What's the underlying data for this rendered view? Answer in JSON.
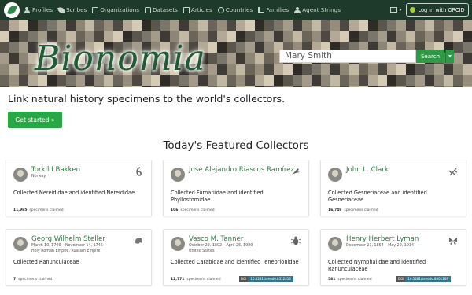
{
  "nav": {
    "items": [
      {
        "label": "Profiles",
        "icon": "profiles-icon"
      },
      {
        "label": "Scribes",
        "icon": "scribes-icon"
      },
      {
        "label": "Organizations",
        "icon": "organizations-icon"
      },
      {
        "label": "Datasets",
        "icon": "datasets-icon"
      },
      {
        "label": "Articles",
        "icon": "articles-icon"
      },
      {
        "label": "Countries",
        "icon": "countries-icon"
      },
      {
        "label": "Families",
        "icon": "families-icon"
      },
      {
        "label": "Agent Strings",
        "icon": "agent-strings-icon"
      }
    ],
    "login_label": "Log in with ORCID"
  },
  "hero": {
    "logo": "Bionomia",
    "search_value": "Mary Smith",
    "search_label": "Search"
  },
  "tagline": "Link natural history specimens to the world's collectors.",
  "cta_label": "Get started »",
  "featured_title": "Today's Featured Collectors",
  "cards": [
    {
      "name": "Torkild Bakken",
      "dates": "Norway",
      "country": "",
      "desc": "Collected Nereididae and identified Nereididae",
      "count": "11,985",
      "count_label": "specimens claimed",
      "doi_key": "",
      "doi_value": "",
      "taxon_icon": "worm-icon"
    },
    {
      "name": "José Alejandro Riascos Ramírez",
      "dates": "",
      "country": "",
      "desc": "Collected Furnariidae and identified Phyllostomidae",
      "count": "106",
      "count_label": "specimens claimed",
      "doi_key": "",
      "doi_value": "",
      "taxon_icon": "bird-icon"
    },
    {
      "name": "John L. Clark",
      "dates": "",
      "country": "",
      "desc": "Collected Gesneriaceae and identified Gesneriaceae",
      "count": "16,749",
      "count_label": "specimens claimed",
      "doi_key": "",
      "doi_value": "",
      "taxon_icon": "plant-icon"
    },
    {
      "name": "Georg Wilhelm Steller",
      "dates": "March 10, 1709 – November 14, 1746",
      "country": "Holy Roman Empire, Russian Empire",
      "desc": "Collected Ranunculaceae",
      "count": "7",
      "count_label": "specimens claimed",
      "doi_key": "",
      "doi_value": "",
      "taxon_icon": "mammal-icon"
    },
    {
      "name": "Vasco M. Tanner",
      "dates": "October 29, 1892 – April 25, 1989",
      "country": "United States",
      "desc": "Collected Carabidae and identified Tenebrionidae",
      "count": "12,771",
      "count_label": "specimens claimed",
      "doi_key": "DOI",
      "doi_value": "10.5281/zenodo.8312413",
      "taxon_icon": "beetle-icon"
    },
    {
      "name": "Henry Herbert Lyman",
      "dates": "December 21, 1854 – May 29, 1914",
      "country": "",
      "desc": "Collected Nymphalidae and identified Ranunculaceae",
      "count": "581",
      "count_label": "specimens claimed",
      "doi_key": "DOI",
      "doi_value": "10.5281/zenodo.8001169",
      "taxon_icon": "butterfly-icon"
    }
  ],
  "colors": {
    "navbar": "#1d3a2a",
    "brand_green": "#28a745",
    "link_green": "#2a7d3e",
    "doi_blue": "#35748d"
  }
}
